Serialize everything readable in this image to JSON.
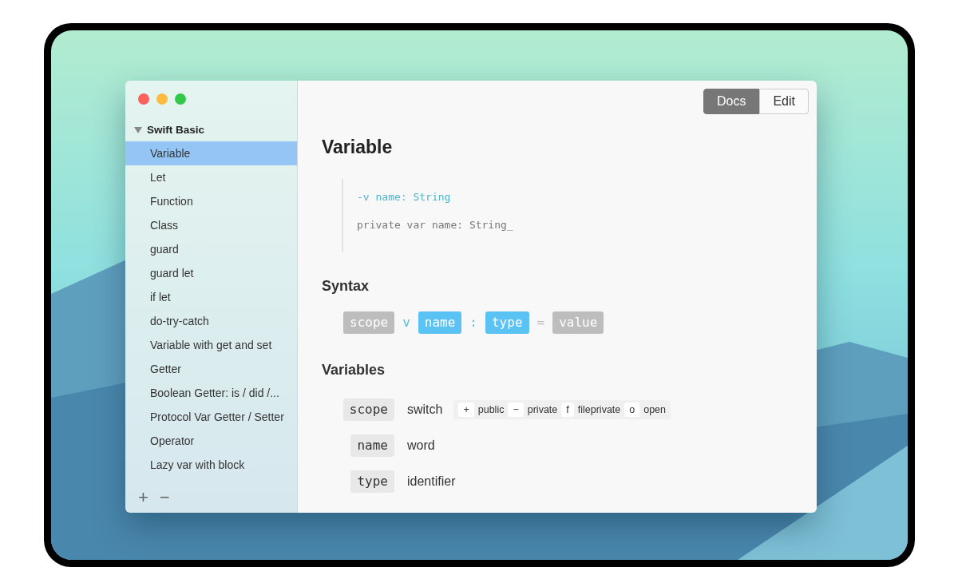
{
  "window": {
    "controls": [
      {
        "kind": "close"
      },
      {
        "kind": "minimize"
      },
      {
        "kind": "zoom"
      }
    ]
  },
  "sidebar": {
    "groups": [
      {
        "label": "Swift Basic",
        "expanded": true,
        "items": [
          {
            "label": "Variable",
            "selected": true
          },
          {
            "label": "Let",
            "selected": false
          },
          {
            "label": "Function",
            "selected": false
          },
          {
            "label": "Class",
            "selected": false
          },
          {
            "label": "guard",
            "selected": false
          },
          {
            "label": "guard let",
            "selected": false
          },
          {
            "label": "if let",
            "selected": false
          },
          {
            "label": "do-try-catch",
            "selected": false
          },
          {
            "label": "Variable with get and set",
            "selected": false
          },
          {
            "label": "Getter",
            "selected": false
          },
          {
            "label": "Boolean Getter: is / did /...",
            "selected": false
          },
          {
            "label": "Protocol Var Getter / Setter",
            "selected": false
          },
          {
            "label": "Operator",
            "selected": false
          },
          {
            "label": "Lazy var with block",
            "selected": false
          }
        ]
      }
    ],
    "footer_buttons": [
      "+",
      "−"
    ]
  },
  "mode_tabs": [
    {
      "label": "Docs",
      "selected": true
    },
    {
      "label": "Edit",
      "selected": false
    }
  ],
  "title": "Variable",
  "code_block": [
    {
      "kind": "hint",
      "text": "-v name: String"
    },
    {
      "kind": "code",
      "text": "private var name: String_"
    }
  ],
  "syntax": {
    "heading": "Syntax",
    "tokens": [
      {
        "kind": "slot",
        "text": "scope",
        "color": "#bdbdbd"
      },
      {
        "kind": "symbol",
        "text": "v",
        "color": "#5bbfdc"
      },
      {
        "kind": "slot",
        "text": "name",
        "color": "#5bc3f3"
      },
      {
        "kind": "symbol",
        "text": ":",
        "color": "#5bbfdc"
      },
      {
        "kind": "slot",
        "text": "type",
        "color": "#5bc3f3"
      },
      {
        "kind": "symbol",
        "text": "=",
        "color": "#bdbdbd"
      },
      {
        "kind": "slot",
        "text": "value",
        "color": "#bdbdbd"
      }
    ]
  },
  "variables": {
    "heading": "Variables",
    "rows": [
      {
        "name": "scope",
        "description": "switch",
        "options": [
          {
            "key": "+",
            "label": "public"
          },
          {
            "key": "−",
            "label": "private"
          },
          {
            "key": "f",
            "label": "fileprivate"
          },
          {
            "key": "o",
            "label": "open"
          }
        ]
      },
      {
        "name": "name",
        "description": "word"
      },
      {
        "name": "type",
        "description": "identifier"
      }
    ]
  }
}
